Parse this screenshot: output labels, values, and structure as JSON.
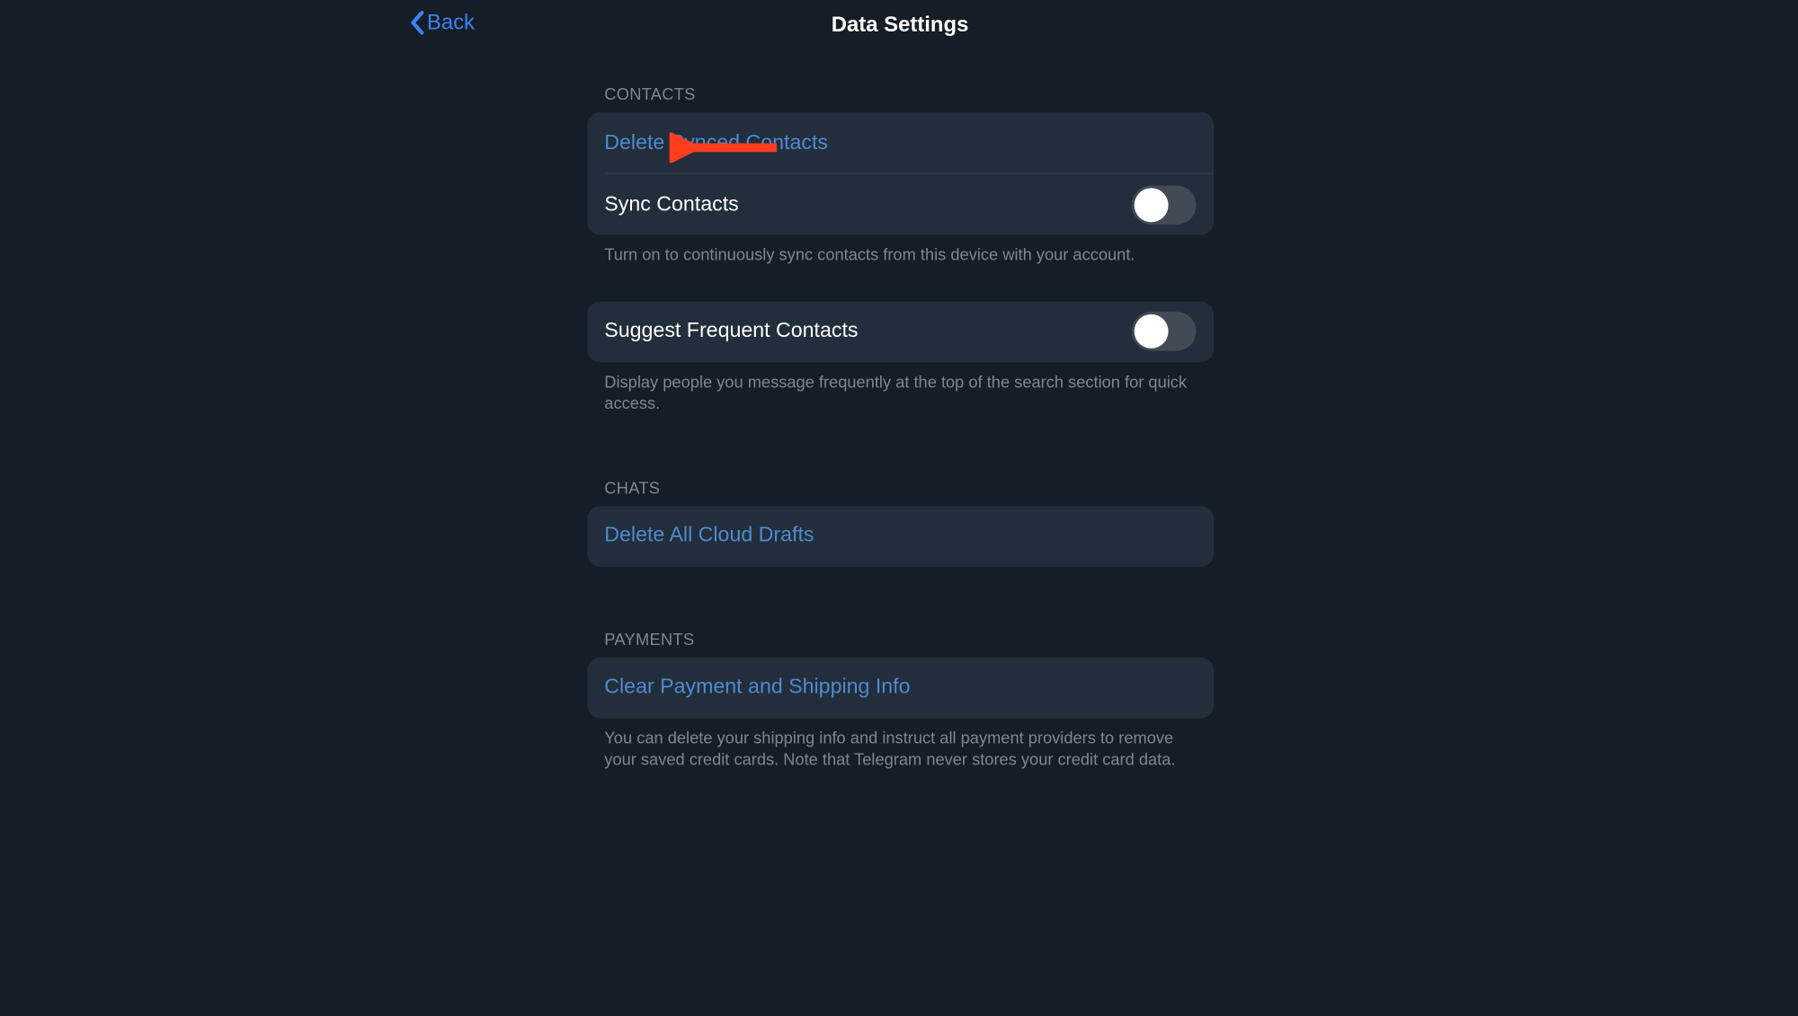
{
  "header": {
    "back_label": "Back",
    "title": "Data Settings"
  },
  "sections": {
    "contacts": {
      "header": "CONTACTS",
      "delete_synced": "Delete Synced Contacts",
      "sync_label": "Sync Contacts",
      "sync_on": false,
      "sync_footer": "Turn on to continuously sync contacts from this device with your account.",
      "suggest_label": "Suggest Frequent Contacts",
      "suggest_on": false,
      "suggest_footer": "Display people you message frequently at the top of the search section for quick access."
    },
    "chats": {
      "header": "CHATS",
      "delete_drafts": "Delete All Cloud Drafts"
    },
    "payments": {
      "header": "PAYMENTS",
      "clear_info": "Clear Payment and Shipping Info",
      "footer": "You can delete your shipping info and instruct all payment providers to remove your saved credit cards. Note that Telegram never stores your credit card data."
    }
  },
  "annotation": {
    "arrow_color": "#ff3e1f"
  }
}
